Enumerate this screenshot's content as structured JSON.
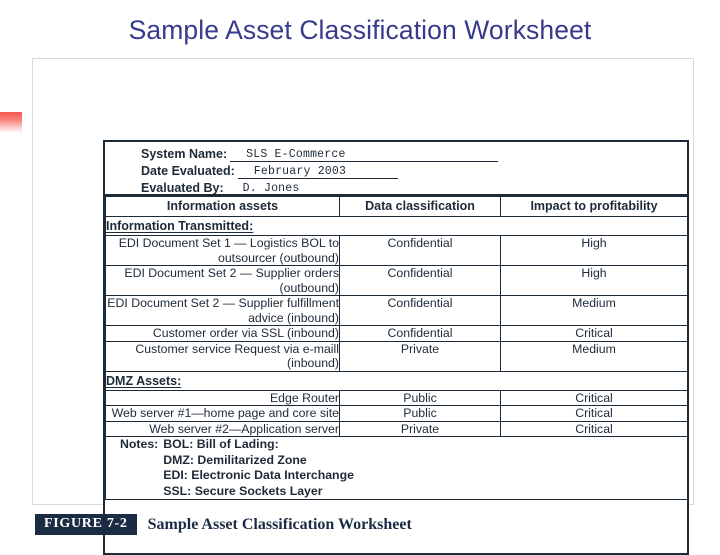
{
  "slide": {
    "title": "Sample Asset Classification Worksheet",
    "title_color": "#373b8c"
  },
  "worksheet": {
    "form": {
      "fields": [
        {
          "label": "System Name:",
          "value": "SLS E-Commerce"
        },
        {
          "label": "Date Evaluated:",
          "value": "February 2003"
        },
        {
          "label": "Evaluated By:",
          "value": "D. Jones"
        }
      ]
    },
    "table": {
      "headers": [
        "Information assets",
        "Data classification",
        "Impact to profitability"
      ],
      "sections": [
        {
          "label": "Information Transmitted:",
          "rows": [
            {
              "asset": "EDI Document Set 1 — Logistics BOL to outsourcer (outbound)",
              "classification": "Confidential",
              "impact": "High"
            },
            {
              "asset": "EDI Document Set 2 — Supplier orders (outbound)",
              "classification": "Confidential",
              "impact": "High"
            },
            {
              "asset": "EDI Document Set 2 — Supplier fulfillment advice (inbound)",
              "classification": "Confidential",
              "impact": "Medium"
            },
            {
              "asset": "Customer order via SSL (inbound)",
              "classification": "Confidential",
              "impact": "Critical"
            },
            {
              "asset": "Customer service Request via e-maill (inbound)",
              "classification": "Private",
              "impact": "Medium"
            }
          ]
        },
        {
          "label": "DMZ Assets:",
          "rows": [
            {
              "asset": "Edge Router",
              "classification": "Public",
              "impact": "Critical"
            },
            {
              "asset": "Web server #1—home page and core site",
              "classification": "Public",
              "impact": "Critical"
            },
            {
              "asset": "Web server #2—Application server",
              "classification": "Private",
              "impact": "Critical"
            }
          ]
        }
      ],
      "notes": {
        "key": "Notes:",
        "items": [
          "BOL: Bill of Lading:",
          "DMZ: Demilitarized Zone",
          "EDI: Electronic Data Interchange",
          "SSL: Secure Sockets Layer"
        ]
      }
    }
  },
  "caption": {
    "figure_number": "FIGURE 7-2",
    "text": "Sample Asset Classification Worksheet",
    "badge_color": "#1b2b44"
  }
}
